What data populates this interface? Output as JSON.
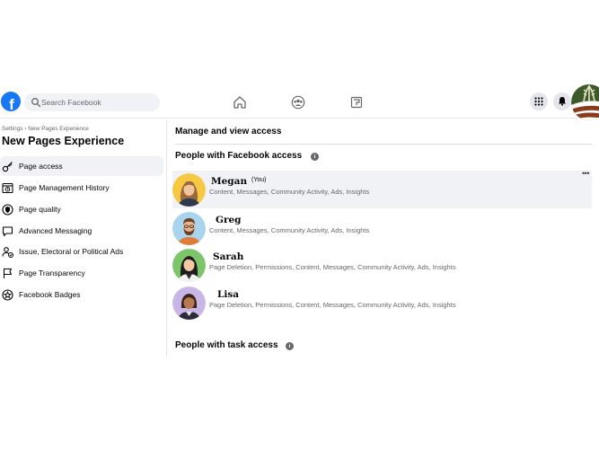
{
  "header": {
    "logo_letter": "f",
    "search": {
      "placeholder": "Search Facebook"
    },
    "nav_icons": [
      "home-icon",
      "groups-icon",
      "pages-icon"
    ],
    "right_icons": [
      "menu-grid-icon",
      "notifications-bell-icon",
      "profile-badge-icon"
    ]
  },
  "sidebar": {
    "breadcrumb": "Settings › New Pages Experience",
    "title": "New Pages Experience",
    "items": [
      {
        "label": "Page access",
        "icon": "key-icon",
        "active": true
      },
      {
        "label": "Page Management History",
        "icon": "history-icon",
        "active": false
      },
      {
        "label": "Page quality",
        "icon": "shield-icon",
        "active": false
      },
      {
        "label": "Advanced Messaging",
        "icon": "message-bubble-icon",
        "active": false
      },
      {
        "label": "Issue, Electoral or Political Ads",
        "icon": "person-ad-icon",
        "active": false
      },
      {
        "label": "Page Transparency",
        "icon": "flag-icon",
        "active": false
      },
      {
        "label": "Facebook Badges",
        "icon": "badge-star-icon",
        "active": false
      }
    ]
  },
  "main": {
    "heading": "Manage and view access",
    "facebook_access": {
      "title": "People with Facebook access",
      "people": [
        {
          "name": "Megan",
          "you_tag": "(You)",
          "permissions": "Content, Messages, Community Activity, Ads, Insights"
        },
        {
          "name": "Greg",
          "permissions": "Content, Messages, Community Activity, Ads, Insights"
        },
        {
          "name": "Sarah",
          "permissions": "Page Deletion, Permissions, Content, Messages, Community Activity, Ads, Insights"
        },
        {
          "name": "Lisa",
          "permissions": "Page Deletion, Permissions, Content, Messages, Community Activity, Ads, Insights"
        }
      ],
      "more_label": "•••"
    },
    "task_access": {
      "title": "People with task access"
    }
  },
  "colors": {
    "brand_blue": "#1877f2",
    "hover_gray": "#f0f2f5",
    "secondary_text": "#65676b",
    "avatar_megan_bg": "#f7c843",
    "avatar_greg_bg": "#a9d4ee",
    "avatar_sarah_bg": "#7cc56a",
    "avatar_lisa_bg": "#c7b6e6"
  }
}
